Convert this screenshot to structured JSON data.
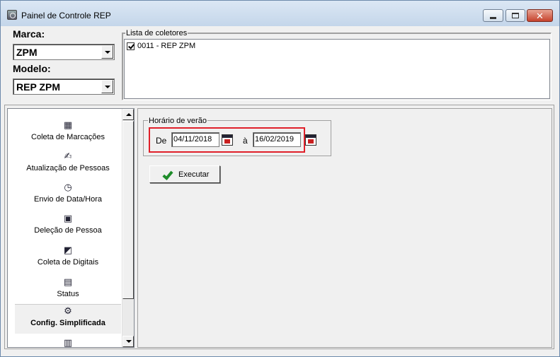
{
  "window": {
    "title": "Painel de Controle REP"
  },
  "top": {
    "marca_label": "Marca:",
    "marca_value": "ZPM",
    "modelo_label": "Modelo:",
    "modelo_value": "REP ZPM",
    "coletores_legend": "Lista de coletores",
    "coletores": [
      {
        "label": "0011 - REP ZPM",
        "checked": true
      }
    ]
  },
  "sidebar": {
    "items": [
      {
        "label": "Coleta de Marcações",
        "icon": "grid-icon"
      },
      {
        "label": "Atualização de Pessoas",
        "icon": "person-edit-icon"
      },
      {
        "label": "Envio de Data/Hora",
        "icon": "clock-icon"
      },
      {
        "label": "Deleção de Pessoa",
        "icon": "person-delete-icon"
      },
      {
        "label": "Coleta de Digitais",
        "icon": "fingerprint-collect-icon"
      },
      {
        "label": "Status",
        "icon": "status-icon"
      },
      {
        "label": "Config. Simplificada",
        "icon": "config-icon",
        "selected": true
      },
      {
        "label": "",
        "icon": "report-icon"
      }
    ]
  },
  "horario": {
    "legend": "Horário de verão",
    "de_label": "De",
    "de_value": "04/11/2018",
    "a_label": "à",
    "a_value": "16/02/2019"
  },
  "actions": {
    "executar_label": "Executar"
  }
}
